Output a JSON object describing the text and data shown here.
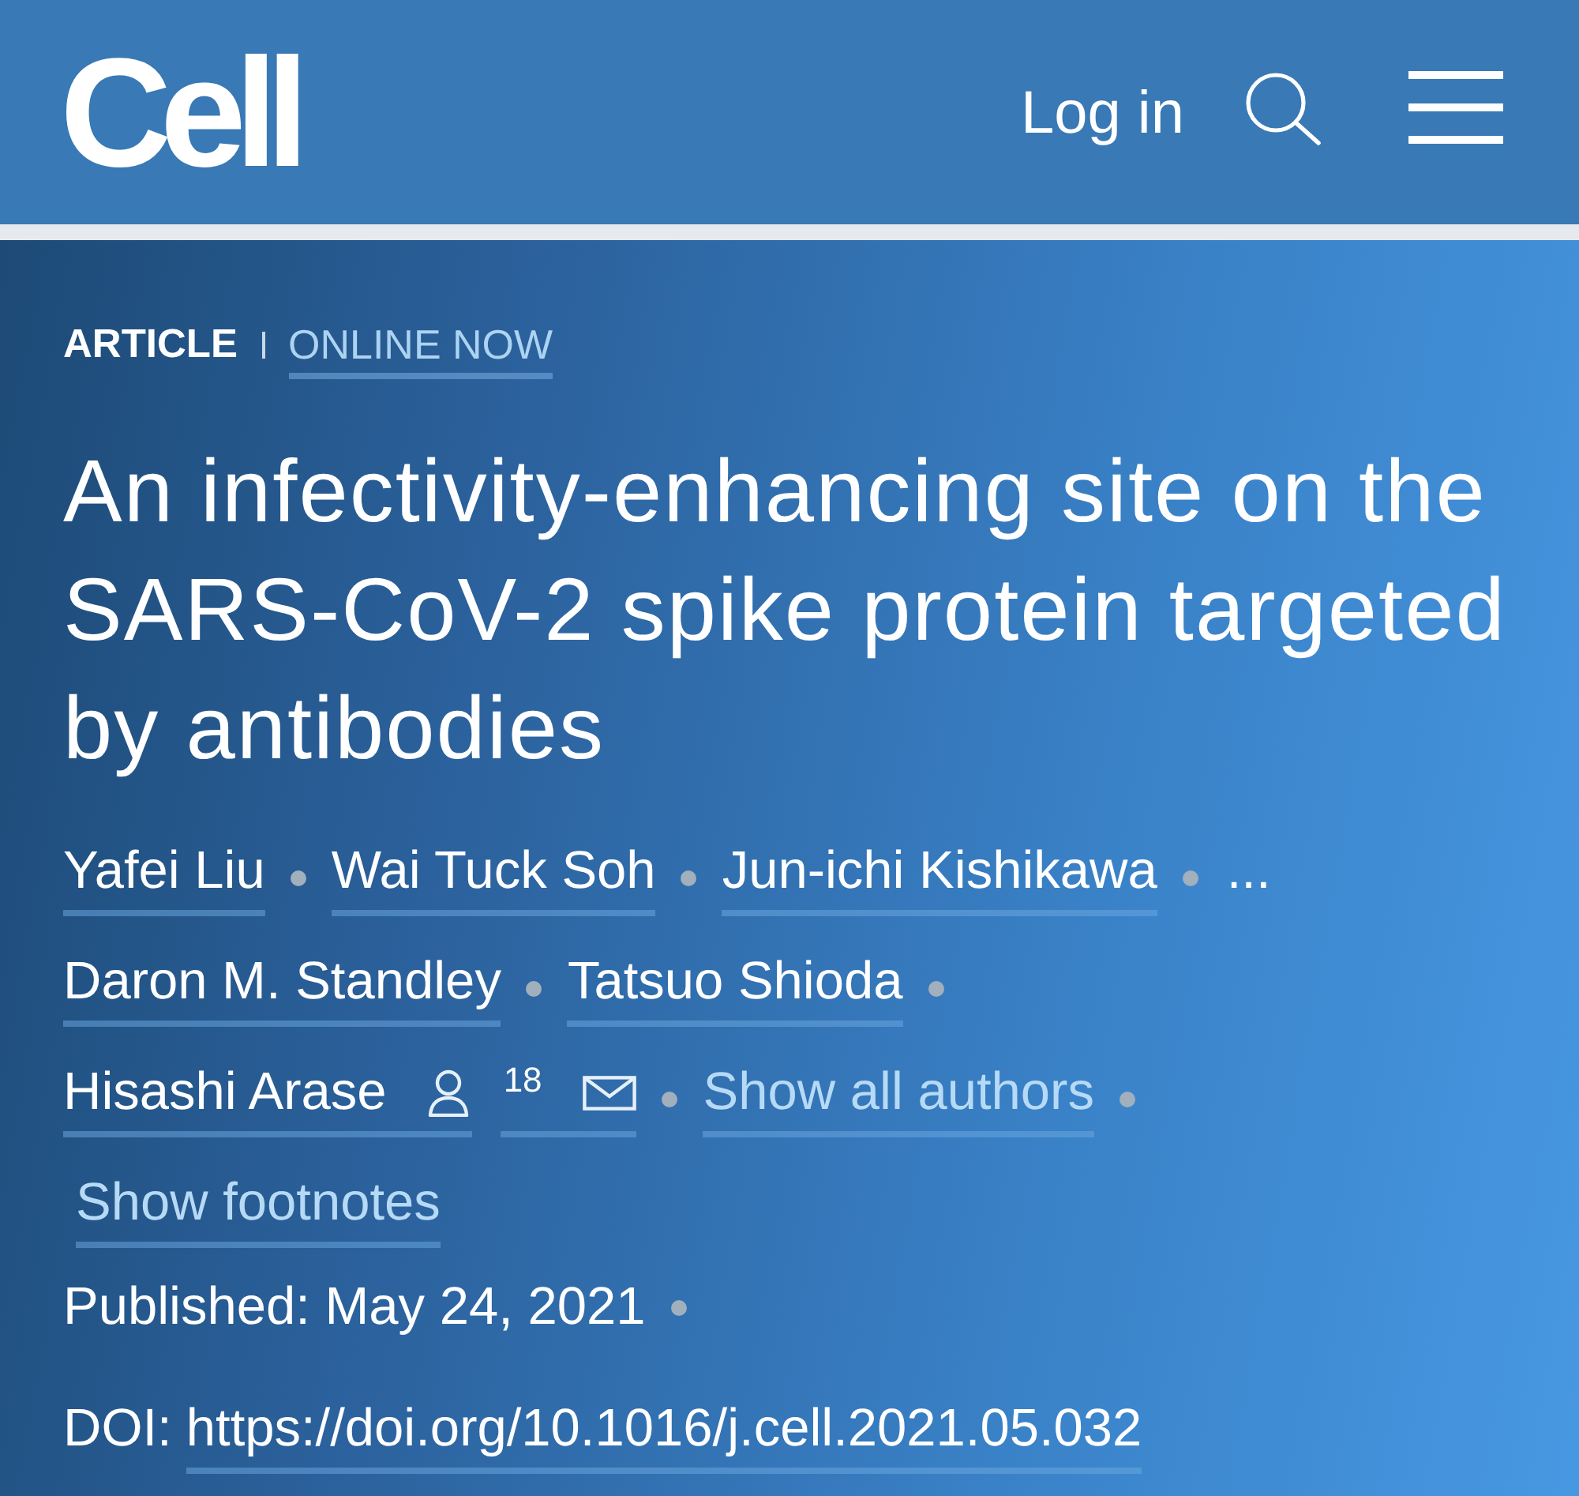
{
  "header": {
    "logo": "Cell",
    "login": "Log in"
  },
  "article": {
    "type": "ARTICLE",
    "status": "ONLINE NOW",
    "title": "An infectivity-enhancing site on the SARS-CoV-2 spike protein targeted by antibodies",
    "author_rows": [
      {
        "items": [
          {
            "kind": "author",
            "name": "Yafei Liu",
            "corresponding": false
          },
          {
            "kind": "author",
            "name": "Wai Tuck Soh",
            "corresponding": false
          },
          {
            "kind": "author",
            "name": "Jun-ichi Kishikawa",
            "corresponding": false
          },
          {
            "kind": "more",
            "text": "..."
          }
        ]
      },
      {
        "items": [
          {
            "kind": "author",
            "name": "Daron M. Standley",
            "corresponding": false
          },
          {
            "kind": "author",
            "name": "Tatsuo Shioda",
            "corresponding": false
          }
        ]
      },
      {
        "items": [
          {
            "kind": "author",
            "name": "Hisashi Arase",
            "corresponding": true,
            "note": "18"
          },
          {
            "kind": "link",
            "text": "Show all authors"
          }
        ]
      }
    ],
    "footnotes_link": "Show footnotes",
    "published": "Published: May 24, 2021",
    "doi": {
      "label": "DOI:",
      "url": "https://doi.org/10.1016/j.cell.2021.05.032"
    }
  }
}
